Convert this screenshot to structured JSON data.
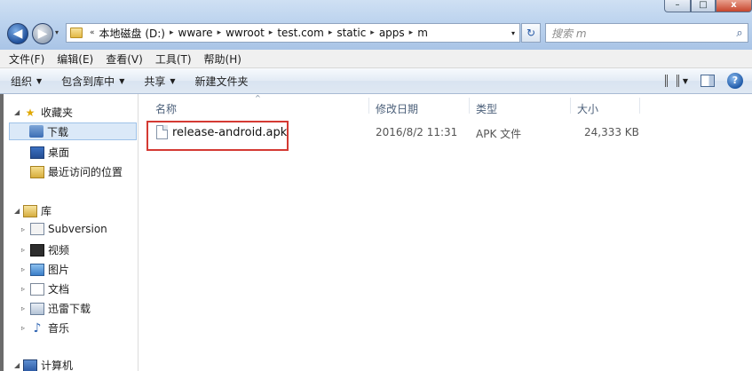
{
  "window": {
    "minimize_label": "–",
    "maximize_label": "□",
    "close_label": "x"
  },
  "nav": {
    "back_glyph": "◀",
    "forward_glyph": "▶",
    "recent_glyph": "▾"
  },
  "address": {
    "overflow": "«",
    "crumbs": [
      "本地磁盘 (D:)",
      "wware",
      "wwroot",
      "test.com",
      "static",
      "apps",
      "m"
    ],
    "separator": "▸",
    "dropdown_glyph": "▾",
    "refresh_glyph": "↻"
  },
  "search": {
    "placeholder": "搜索 m",
    "icon": "search-icon",
    "glyph": "⌕"
  },
  "menu": {
    "items": [
      "文件(F)",
      "编辑(E)",
      "查看(V)",
      "工具(T)",
      "帮助(H)"
    ]
  },
  "toolbar": {
    "organize": "组织",
    "include_in_library": "包含到库中",
    "share": "共享",
    "new_folder": "新建文件夹",
    "dropdown_glyph": "▼",
    "help_glyph": "?"
  },
  "sidebar": {
    "favorites": "收藏夹",
    "downloads": "下载",
    "desktop": "桌面",
    "recent_places": "最近访问的位置",
    "libraries": "库",
    "subversion": "Subversion",
    "videos": "视频",
    "pictures": "图片",
    "documents": "文档",
    "xunlei": "迅雷下载",
    "music": "音乐",
    "computer": "计算机",
    "expanded_glyph": "◢",
    "collapsed_glyph": "▹",
    "star_glyph": "★",
    "music_glyph": "♪"
  },
  "columns": {
    "name": "名称",
    "date_modified": "修改日期",
    "type": "类型",
    "size": "大小",
    "sort_glyph": "^"
  },
  "files": [
    {
      "name": "release-android.apk",
      "date_modified": "2016/8/2 11:31",
      "type": "APK 文件",
      "size": "24,333 KB"
    }
  ],
  "colors": {
    "highlight_box": "#d43a33",
    "selection_bg": "#dbe9f8",
    "title_gradient": "#bcd3ee"
  }
}
